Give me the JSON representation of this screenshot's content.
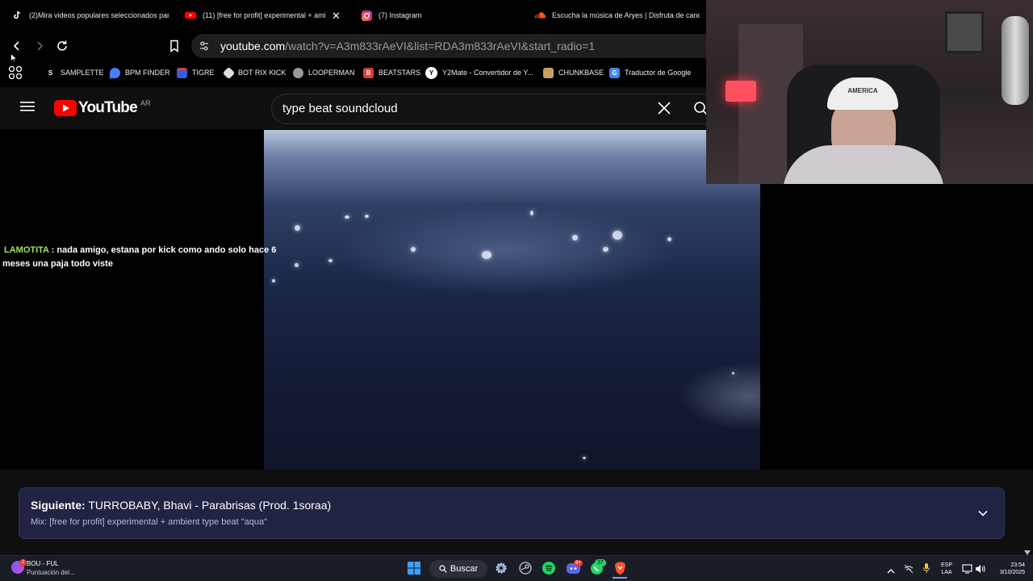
{
  "browser": {
    "tabs": [
      {
        "title": "(2)Mira videos populares seleccionados para",
        "icon": "tiktok-icon"
      },
      {
        "title": "(11) [free for profit] experimental + ami",
        "icon": "youtube-icon"
      },
      {
        "title": "(7) Instagram",
        "icon": "instagram-icon"
      },
      {
        "title": "Escucha la música de Aryes | Disfruta de canc",
        "icon": "soundcloud-icon"
      }
    ],
    "url_host": "youtube.com",
    "url_path": "/watch?v=A3m833rAeVI&list=RDA3m833rAeVI&start_radio=1",
    "bookmarks": [
      {
        "label": "SAMPLETTE",
        "icon": "samplette-icon",
        "color": "#ffffff"
      },
      {
        "label": "BPM FINDER",
        "icon": "bpm-icon",
        "color": "#4a7cff"
      },
      {
        "label": "TIGRE",
        "icon": "tigre-icon",
        "color": "#3b5bdb"
      },
      {
        "label": "BOT RIX KICK",
        "icon": "bot-icon",
        "color": "#dddddd"
      },
      {
        "label": "LOOPERMAN",
        "icon": "looperman-icon",
        "color": "#aaaaaa"
      },
      {
        "label": "BEATSTARS",
        "icon": "beatstars-icon",
        "color": "#e53935"
      },
      {
        "label": "Y2Mate - Convertidor de Y...",
        "icon": "y2mate-icon",
        "color": "#ffffff"
      },
      {
        "label": "CHUNKBASE",
        "icon": "chunkbase-icon",
        "color": "#c8a060"
      },
      {
        "label": "Traductor de Google",
        "icon": "google-translate-icon",
        "color": "#4285f4"
      }
    ]
  },
  "youtube": {
    "logo_text": "YouTube",
    "region": "AR",
    "search_query": "type beat soundcloud"
  },
  "chat": {
    "user": "LAMOTITA",
    "message": " : nada amigo, estana por kick como ando solo hace 6 meses una paja todo viste"
  },
  "up_next": {
    "label": "Siguiente:",
    "title": "TURROBABY, Bhavi - Parabrisas (Prod. 1soraa)",
    "mix": "Mix: [free for profit] experimental + ambient type beat \"aqua\""
  },
  "webcam": {
    "cap_text": "AMERICA"
  },
  "taskbar": {
    "notification_app": "BOU - FUL",
    "notification_sub": "Puntuación del...",
    "notification_badge": "2",
    "search_label": "Buscar",
    "discord_badge": "9+",
    "whatsapp_badge": "37",
    "lang_top": "ESP",
    "lang_bottom": "LAA",
    "time": "23:54",
    "date": "3/10/2025"
  },
  "colors": {
    "accent_red": "#ff0000",
    "chat_user": "#9ae85a",
    "next_card_bg": "#212343"
  }
}
